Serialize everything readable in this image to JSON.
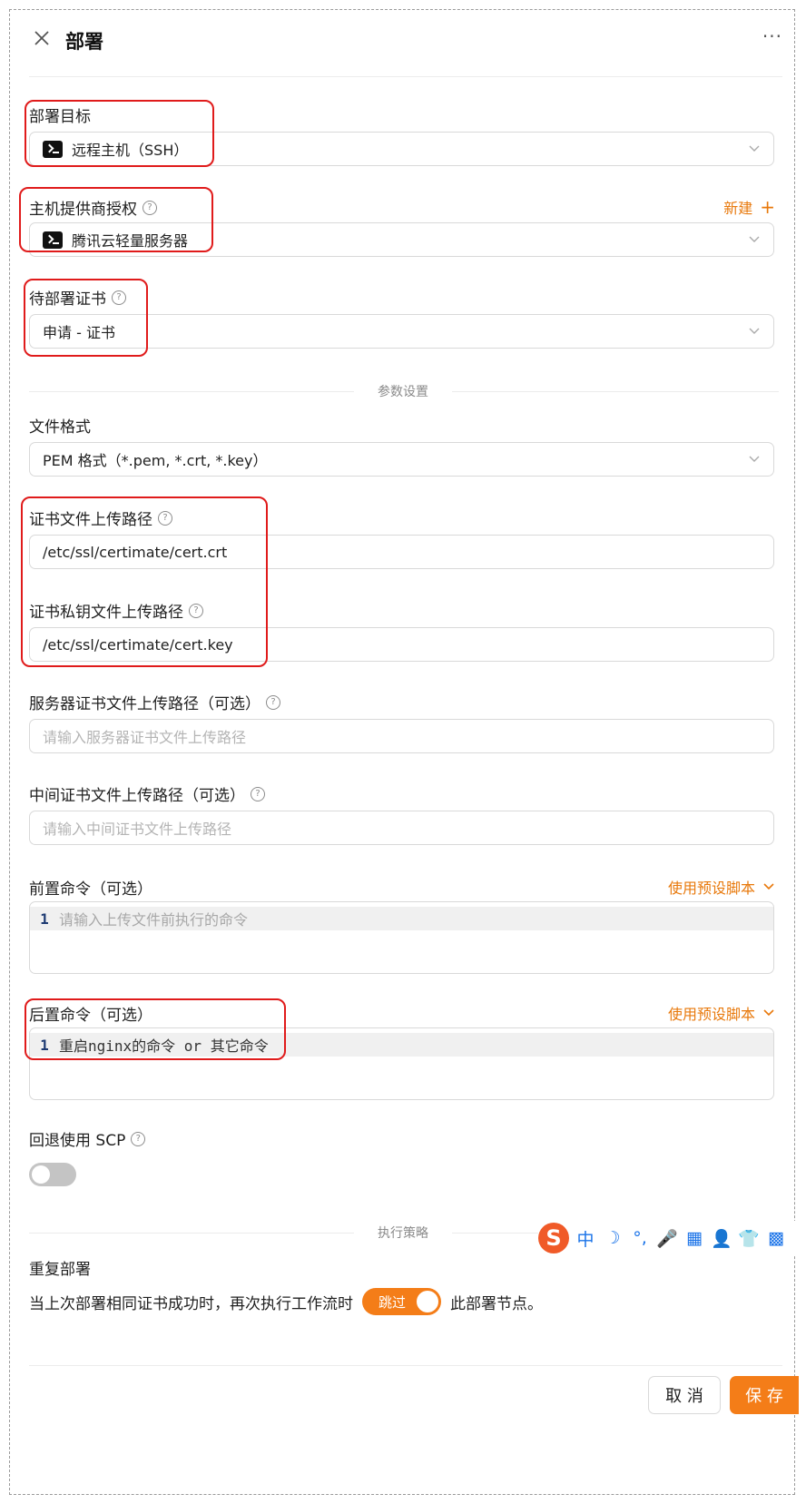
{
  "header": {
    "title": "部署",
    "more": "···"
  },
  "deploy_target": {
    "label": "部署目标",
    "value": "远程主机（SSH）"
  },
  "provider_auth": {
    "label": "主机提供商授权",
    "new_label": "新建",
    "value": "腾讯云轻量服务器"
  },
  "cert": {
    "label": "待部署证书",
    "value": "申请 - 证书"
  },
  "section_params": "参数设置",
  "file_format": {
    "label": "文件格式",
    "value": "PEM 格式（*.pem, *.crt, *.key）"
  },
  "cert_path": {
    "label": "证书文件上传路径",
    "value": "/etc/ssl/certimate/cert.crt"
  },
  "key_path": {
    "label": "证书私钥文件上传路径",
    "value": "/etc/ssl/certimate/cert.key"
  },
  "server_cert_path": {
    "label": "服务器证书文件上传路径（可选）",
    "placeholder": "请输入服务器证书文件上传路径"
  },
  "intermediate_path": {
    "label": "中间证书文件上传路径（可选）",
    "placeholder": "请输入中间证书文件上传路径"
  },
  "pre_command": {
    "label": "前置命令（可选）",
    "preset": "使用预设脚本",
    "line_no": "1",
    "placeholder": "请输入上传文件前执行的命令"
  },
  "post_command": {
    "label": "后置命令（可选）",
    "preset": "使用预设脚本",
    "line_no": "1",
    "value": "重启nginx的命令 or 其它命令"
  },
  "fallback_scp": {
    "label": "回退使用 SCP",
    "enabled": false
  },
  "section_strategy": "执行策略",
  "repeat": {
    "title": "重复部署",
    "prefix": "当上次部署相同证书成功时，再次执行工作流时",
    "toggle_label": "跳过",
    "suffix": "此部署节点。"
  },
  "ime_toolbar": {
    "logo": "S",
    "items": [
      "中",
      "☽",
      "°,",
      "🎤",
      "▦",
      "👤",
      "👕",
      "▩"
    ]
  },
  "footer": {
    "cancel": "取 消",
    "save": "保 存"
  },
  "colors": {
    "accent": "#f47d18",
    "annotation": "#e01b1b",
    "border": "#d9d9d9"
  }
}
